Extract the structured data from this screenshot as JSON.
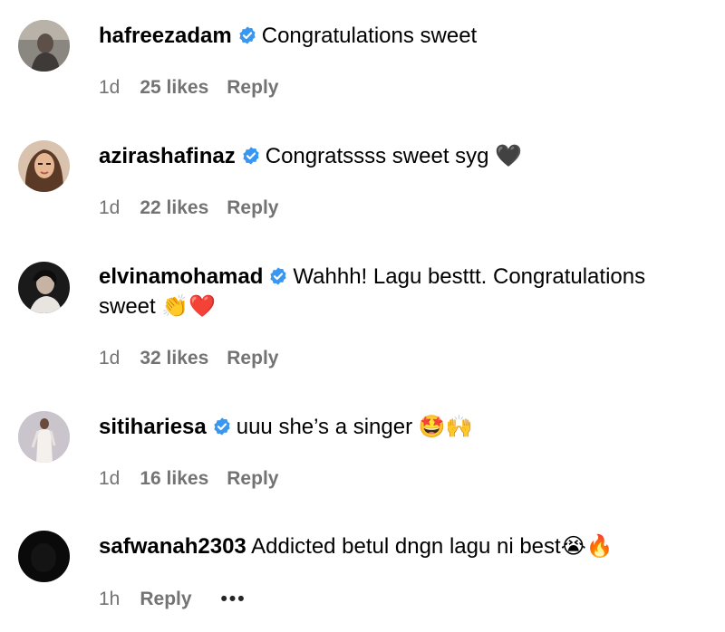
{
  "comments": [
    {
      "username": "hafreezadam",
      "text": "Congratulations sweet",
      "time": "1d",
      "likes": "25 likes",
      "reply": "Reply"
    },
    {
      "username": "azirashafinaz",
      "text": "Congratssss sweet syg",
      "emoji": "🖤",
      "time": "1d",
      "likes": "22 likes",
      "reply": "Reply"
    },
    {
      "username": "elvinamohamad",
      "text": "Wahhh! Lagu besttt. Congratulations sweet",
      "emoji": "👏❤️",
      "time": "1d",
      "likes": "32 likes",
      "reply": "Reply"
    },
    {
      "username": "sitihariesa",
      "text": "uuu she’s a singer",
      "emoji": "🤩🙌",
      "time": "1d",
      "likes": "16 likes",
      "reply": "Reply"
    },
    {
      "username": "safwanah2303",
      "text": "Addicted betul dngn lagu ni best",
      "emoji": "😭🔥",
      "time": "1h",
      "reply": "Reply",
      "more": "•••"
    }
  ],
  "colors": {
    "verified": "#3897f0",
    "meta": "#737373"
  }
}
